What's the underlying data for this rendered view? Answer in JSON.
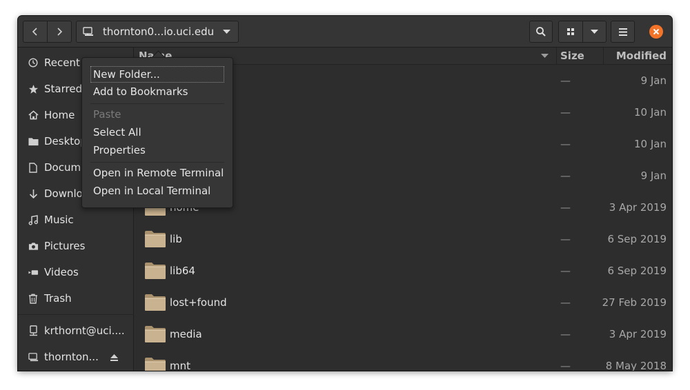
{
  "window": {
    "location_label": "thornton0...io.uci.edu"
  },
  "columns": {
    "name": "Name",
    "size": "Size",
    "modified": "Modified"
  },
  "sidebar": {
    "items": [
      {
        "label": "Recent",
        "icon": "clock-icon"
      },
      {
        "label": "Starred",
        "icon": "star-icon"
      },
      {
        "label": "Home",
        "icon": "home-icon"
      },
      {
        "label": "Desktop",
        "icon": "folder-icon"
      },
      {
        "label": "Documents",
        "icon": "document-icon"
      },
      {
        "label": "Downloads",
        "icon": "download-icon"
      },
      {
        "label": "Music",
        "icon": "music-icon"
      },
      {
        "label": "Pictures",
        "icon": "camera-icon"
      },
      {
        "label": "Videos",
        "icon": "video-icon"
      },
      {
        "label": "Trash",
        "icon": "trash-icon"
      }
    ],
    "mounts": [
      {
        "label": "krthornt@uci....",
        "icon": "network-drive-icon"
      },
      {
        "label": "thornton...",
        "icon": "network-folder-icon",
        "eject": true
      }
    ]
  },
  "files": [
    {
      "name": "",
      "size": "—",
      "modified": "9 Jan"
    },
    {
      "name": "",
      "size": "—",
      "modified": "10 Jan"
    },
    {
      "name": "",
      "size": "—",
      "modified": "10 Jan"
    },
    {
      "name": "",
      "size": "—",
      "modified": "9 Jan"
    },
    {
      "name": "home",
      "size": "—",
      "modified": "3 Apr 2019"
    },
    {
      "name": "lib",
      "size": "—",
      "modified": "6 Sep 2019"
    },
    {
      "name": "lib64",
      "size": "—",
      "modified": "6 Sep 2019"
    },
    {
      "name": "lost+found",
      "size": "—",
      "modified": "27 Feb 2019"
    },
    {
      "name": "media",
      "size": "—",
      "modified": "3 Apr 2019"
    },
    {
      "name": "mnt",
      "size": "—",
      "modified": "8 May 2018"
    }
  ],
  "context_menu": {
    "new_folder": "New Folder...",
    "add_bookmarks": "Add to Bookmarks",
    "paste": "Paste",
    "select_all": "Select All",
    "properties": "Properties",
    "open_remote_terminal": "Open in Remote Terminal",
    "open_local_terminal": "Open in Local Terminal"
  },
  "colors": {
    "close_button": "#f37329",
    "folder": "#c9b28f",
    "background": "#2d2d2d"
  }
}
